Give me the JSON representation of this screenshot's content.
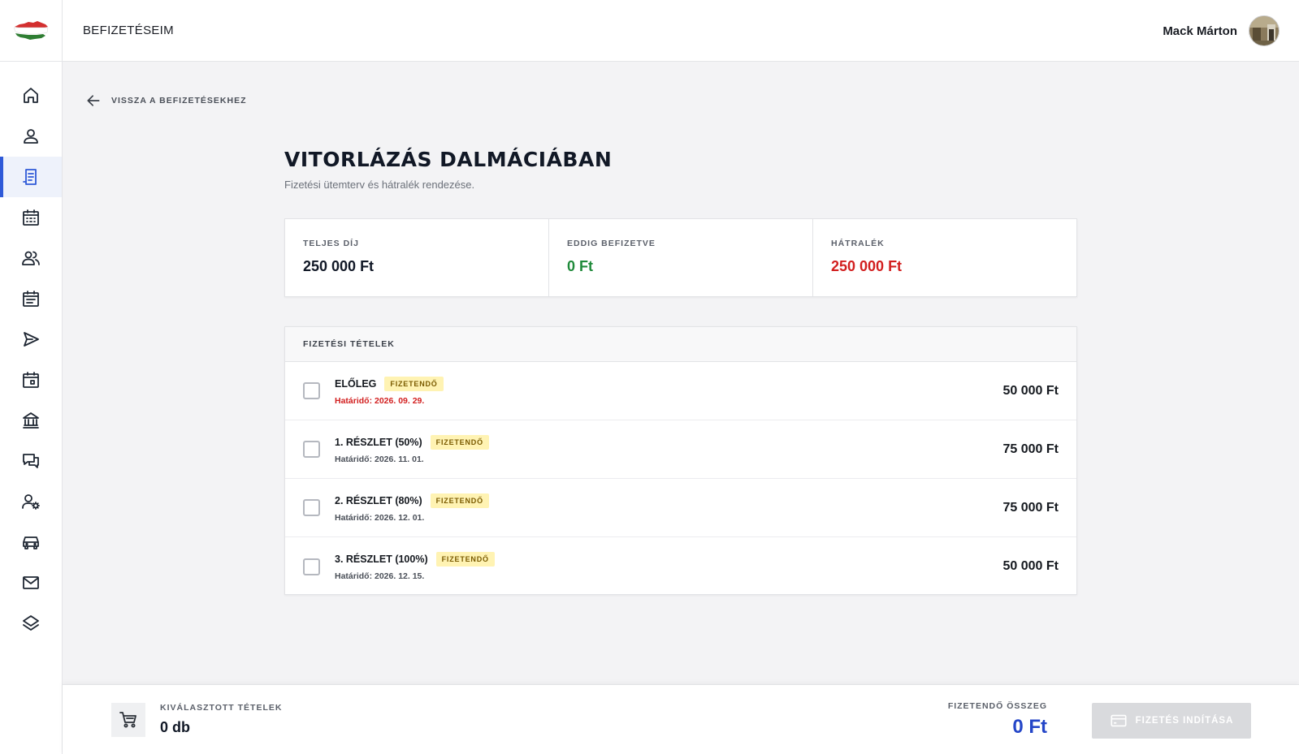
{
  "header": {
    "title": "BEFIZETÉSEIM",
    "user_name": "Mack Márton"
  },
  "sidebar": {
    "items": [
      {
        "icon": "home-icon"
      },
      {
        "icon": "user-icon"
      },
      {
        "icon": "receipt-icon",
        "active": true
      },
      {
        "icon": "calendar-grid-icon"
      },
      {
        "icon": "users-icon"
      },
      {
        "icon": "calendar-list-icon"
      },
      {
        "icon": "send-icon"
      },
      {
        "icon": "calendar-event-icon"
      },
      {
        "icon": "bank-icon"
      },
      {
        "icon": "chat-icon"
      },
      {
        "icon": "user-settings-icon"
      },
      {
        "icon": "car-icon"
      },
      {
        "icon": "mail-icon"
      },
      {
        "icon": "layers-icon"
      }
    ]
  },
  "back_link": {
    "label": "VISSZA A BEFIZETÉSEKHEZ"
  },
  "page": {
    "title": "VITORLÁZÁS DALMÁCIÁBAN",
    "subtitle": "Fizetési ütemterv és hátralék rendezése."
  },
  "summary": {
    "total_label": "TELJES DÍJ",
    "total_value": "250 000 Ft",
    "paid_label": "EDDIG BEFIZETVE",
    "paid_value": "0 Ft",
    "due_label": "HÁTRALÉK",
    "due_value": "250 000 Ft",
    "colors": {
      "paid": "#1f8a3a",
      "due": "#d21f1f"
    }
  },
  "items": {
    "header": "FIZETÉSI TÉTELEK",
    "rows": [
      {
        "name": "ELŐLEG",
        "badge": "FIZETENDŐ",
        "due": "Határidő: 2026. 09. 29.",
        "amount": "50 000 Ft",
        "overdue": true,
        "checked": false
      },
      {
        "name": "1. RÉSZLET (50%)",
        "badge": "FIZETENDŐ",
        "due": "Határidő: 2026. 11. 01.",
        "amount": "75 000 Ft",
        "overdue": false,
        "checked": false
      },
      {
        "name": "2. RÉSZLET (80%)",
        "badge": "FIZETENDŐ",
        "due": "Határidő: 2026. 12. 01.",
        "amount": "75 000 Ft",
        "overdue": false,
        "checked": false
      },
      {
        "name": "3. RÉSZLET (100%)",
        "badge": "FIZETENDŐ",
        "due": "Határidő: 2026. 12. 15.",
        "amount": "50 000 Ft",
        "overdue": false,
        "checked": false
      }
    ]
  },
  "footer": {
    "selected_label": "KIVÁLASZTOTT TÉTELEK",
    "selected_value": "0 db",
    "total_label": "FIZETENDŐ ÖSSZEG",
    "total_value": "0 Ft",
    "pay_button": "FIZETÉS INDÍTÁSA",
    "accent": "#2446c8"
  }
}
